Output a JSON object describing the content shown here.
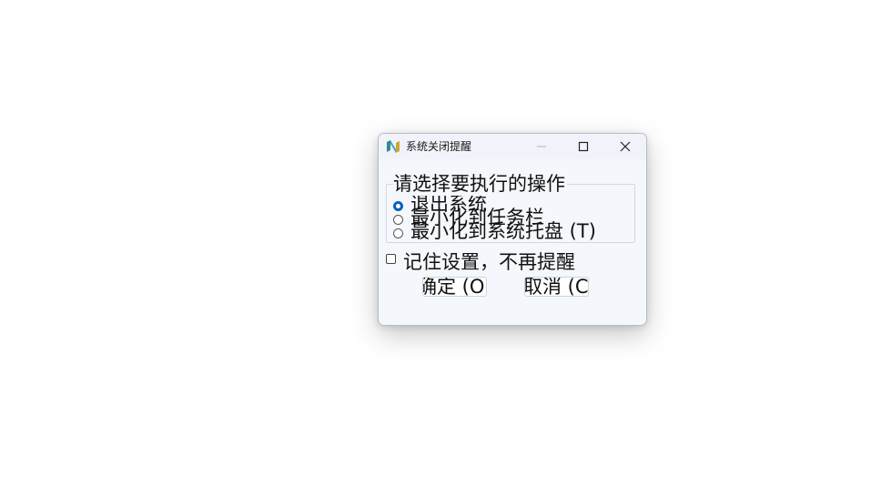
{
  "window": {
    "title": "系统关闭提醒"
  },
  "group": {
    "title": "请选择要执行的操作",
    "options": [
      {
        "label": "退出系统",
        "checked": true
      },
      {
        "label": "最小化到任务栏",
        "checked": false
      },
      {
        "label": "最小化到系统托盘 (T)",
        "checked": false
      }
    ]
  },
  "remember": {
    "label": "记住设置，不再提醒",
    "checked": false
  },
  "buttons": {
    "ok_label": "确定 (O",
    "cancel_label": "取消 (C"
  },
  "icons": {
    "app": "app-logo-icon",
    "minimize": "minimize-icon",
    "maximize": "maximize-icon",
    "close": "close-icon"
  },
  "colors": {
    "accent": "#0a5fbf",
    "window_bg": "#f4f7fb"
  }
}
